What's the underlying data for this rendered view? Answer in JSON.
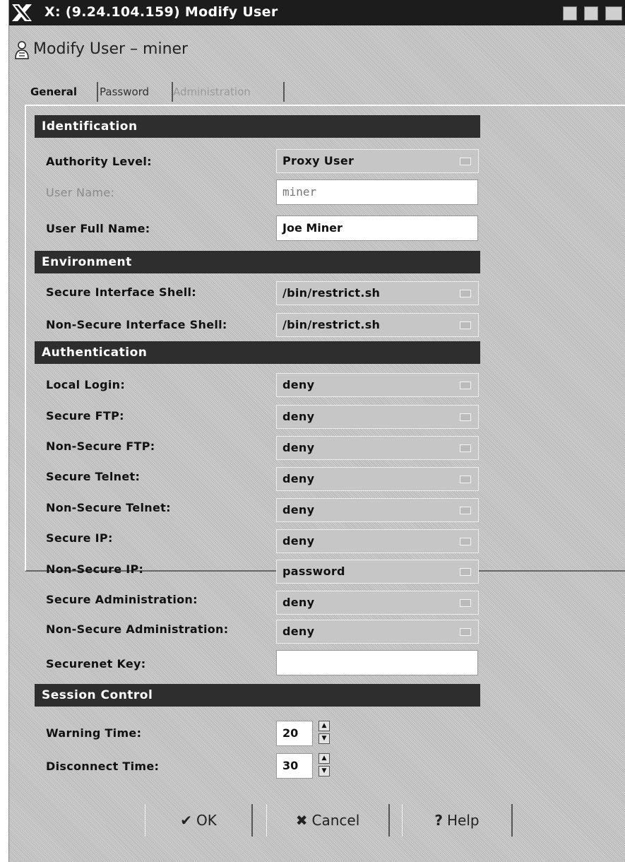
{
  "window": {
    "title": "X: (9.24.104.159) Modify User"
  },
  "header": {
    "title": "Modify User – miner"
  },
  "tabs": [
    "General",
    "Password",
    "Administration"
  ],
  "sections": {
    "identification": "Identification",
    "environment": "Environment",
    "authentication": "Authentication",
    "session_control": "Session Control"
  },
  "fields": {
    "authority_level": {
      "label": "Authority Level:",
      "value": "Proxy User"
    },
    "user_name": {
      "label": "User Name:",
      "value": "miner"
    },
    "user_full_name": {
      "label": "User Full Name:",
      "value": "Joe Miner"
    },
    "secure_shell": {
      "label": "Secure Interface Shell:",
      "value": "/bin/restrict.sh"
    },
    "nonsecure_shell": {
      "label": "Non-Secure Interface Shell:",
      "value": "/bin/restrict.sh"
    },
    "local_login": {
      "label": "Local Login:",
      "value": "deny"
    },
    "secure_ftp": {
      "label": "Secure FTP:",
      "value": "deny"
    },
    "nonsecure_ftp": {
      "label": "Non-Secure FTP:",
      "value": "deny"
    },
    "secure_telnet": {
      "label": "Secure Telnet:",
      "value": "deny"
    },
    "nonsecure_telnet": {
      "label": "Non-Secure Telnet:",
      "value": "deny"
    },
    "secure_ip": {
      "label": "Secure IP:",
      "value": "deny"
    },
    "nonsecure_ip": {
      "label": "Non-Secure IP:",
      "value": "password"
    },
    "secure_admin": {
      "label": "Secure Administration:",
      "value": "deny"
    },
    "nonsecure_admin": {
      "label": "Non-Secure Administration:",
      "value": "deny"
    },
    "securenet_key": {
      "label": "Securenet Key:",
      "value": ""
    },
    "warning_time": {
      "label": "Warning Time:",
      "value": "20"
    },
    "disconnect_time": {
      "label": "Disconnect Time:",
      "value": "30"
    }
  },
  "buttons": {
    "ok": "OK",
    "cancel": "Cancel",
    "help": "Help"
  },
  "icons": {
    "window": "x-logo-icon",
    "header": "user-icon",
    "ok": "checkmark-icon",
    "cancel": "x-icon",
    "help": "question-icon"
  },
  "colors": {
    "titlebar": "#1c1c1c",
    "section_header": "#2e2e2e",
    "background": "#c9c9c9"
  }
}
